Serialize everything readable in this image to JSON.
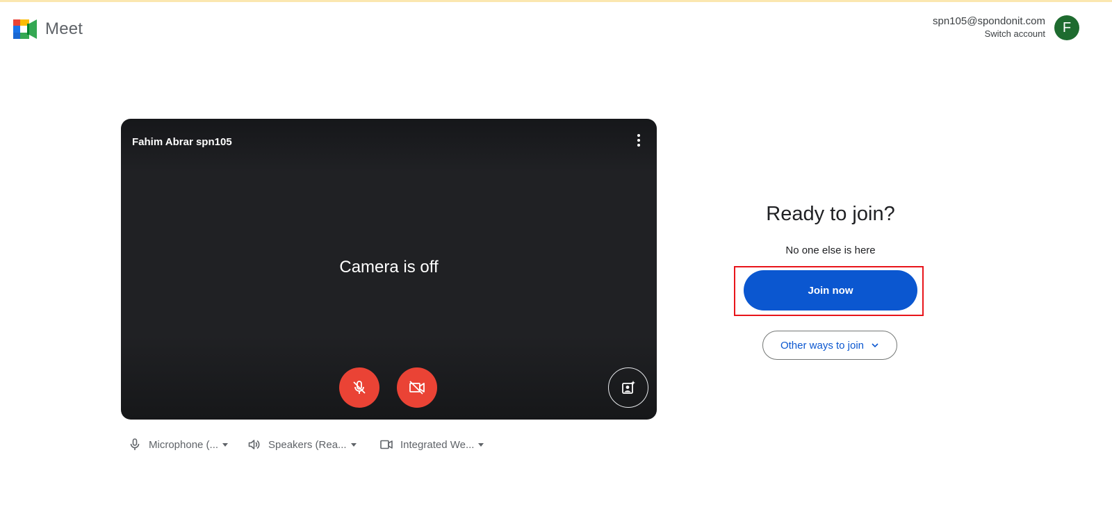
{
  "app": {
    "name": "Meet",
    "accent_color": "#0b57d0"
  },
  "account": {
    "email": "spn105@spondonit.com",
    "switch_label": "Switch account",
    "avatar_initial": "F",
    "avatar_color": "#1e6b2f"
  },
  "preview": {
    "participant_name": "Fahim Abrar spn105",
    "camera_status": "Camera is off",
    "mic_button_icon": "mic-off-icon",
    "camera_button_icon": "videocam-off-icon",
    "effects_icon": "visual-effects-icon",
    "more_icon": "more-vert-icon",
    "off_button_color": "#ea4335"
  },
  "devices": {
    "microphone": "Microphone (...",
    "speakers": "Speakers (Rea...",
    "camera": "Integrated We..."
  },
  "join": {
    "title": "Ready to join?",
    "status": "No one else is here",
    "join_label": "Join now",
    "other_label": "Other ways to join",
    "highlight_color": "#e8141a"
  }
}
